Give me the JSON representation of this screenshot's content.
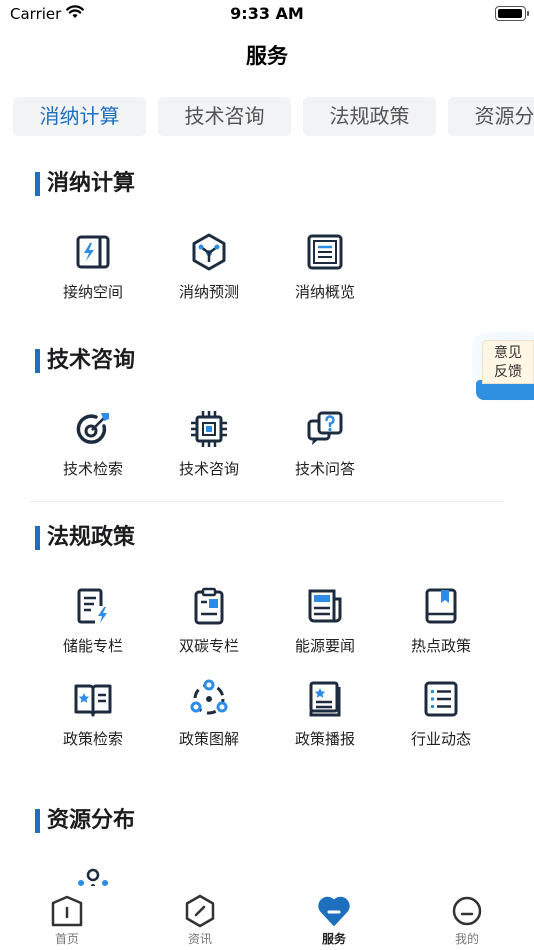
{
  "status_bar": {
    "carrier": "Carrier",
    "time": "9:33 AM"
  },
  "nav": {
    "title": "服务"
  },
  "tabs": [
    {
      "label": "消纳计算",
      "active": true
    },
    {
      "label": "技术咨询",
      "active": false
    },
    {
      "label": "法规政策",
      "active": false
    },
    {
      "label": "资源分布",
      "active": false
    }
  ],
  "sections": {
    "consumption": {
      "title": "消纳计算",
      "items": [
        {
          "label": "接纳空间",
          "icon": "access-space-icon"
        },
        {
          "label": "消纳预测",
          "icon": "consumption-forecast-icon"
        },
        {
          "label": "消纳概览",
          "icon": "consumption-overview-icon"
        }
      ]
    },
    "tech": {
      "title": "技术咨询",
      "items": [
        {
          "label": "技术检索",
          "icon": "target-search-icon"
        },
        {
          "label": "技术咨询",
          "icon": "chip-icon"
        },
        {
          "label": "技术问答",
          "icon": "question-bubble-icon"
        }
      ]
    },
    "policy": {
      "title": "法规政策",
      "items": [
        {
          "label": "储能专栏",
          "icon": "storage-doc-icon"
        },
        {
          "label": "双碳专栏",
          "icon": "carbon-clipboard-icon"
        },
        {
          "label": "能源要闻",
          "icon": "news-paper-icon"
        },
        {
          "label": "热点政策",
          "icon": "bookmark-book-icon"
        },
        {
          "label": "政策检索",
          "icon": "star-book-icon"
        },
        {
          "label": "政策图解",
          "icon": "network-nodes-icon"
        },
        {
          "label": "政策播报",
          "icon": "broadcast-book-icon"
        },
        {
          "label": "行业动态",
          "icon": "list-doc-icon"
        }
      ]
    },
    "resource": {
      "title": "资源分布"
    }
  },
  "feedback": {
    "line1": "意见",
    "line2": "反馈"
  },
  "tabbar": [
    {
      "label": "首页",
      "icon": "home-icon"
    },
    {
      "label": "资讯",
      "icon": "news-compass-icon"
    },
    {
      "label": "服务",
      "icon": "service-heart-icon",
      "active": true
    },
    {
      "label": "我的",
      "icon": "profile-face-icon"
    }
  ],
  "colors": {
    "accent": "#1f6fbf",
    "icon_dark": "#1d2b3f",
    "tab_bg": "#f2f3f5"
  }
}
